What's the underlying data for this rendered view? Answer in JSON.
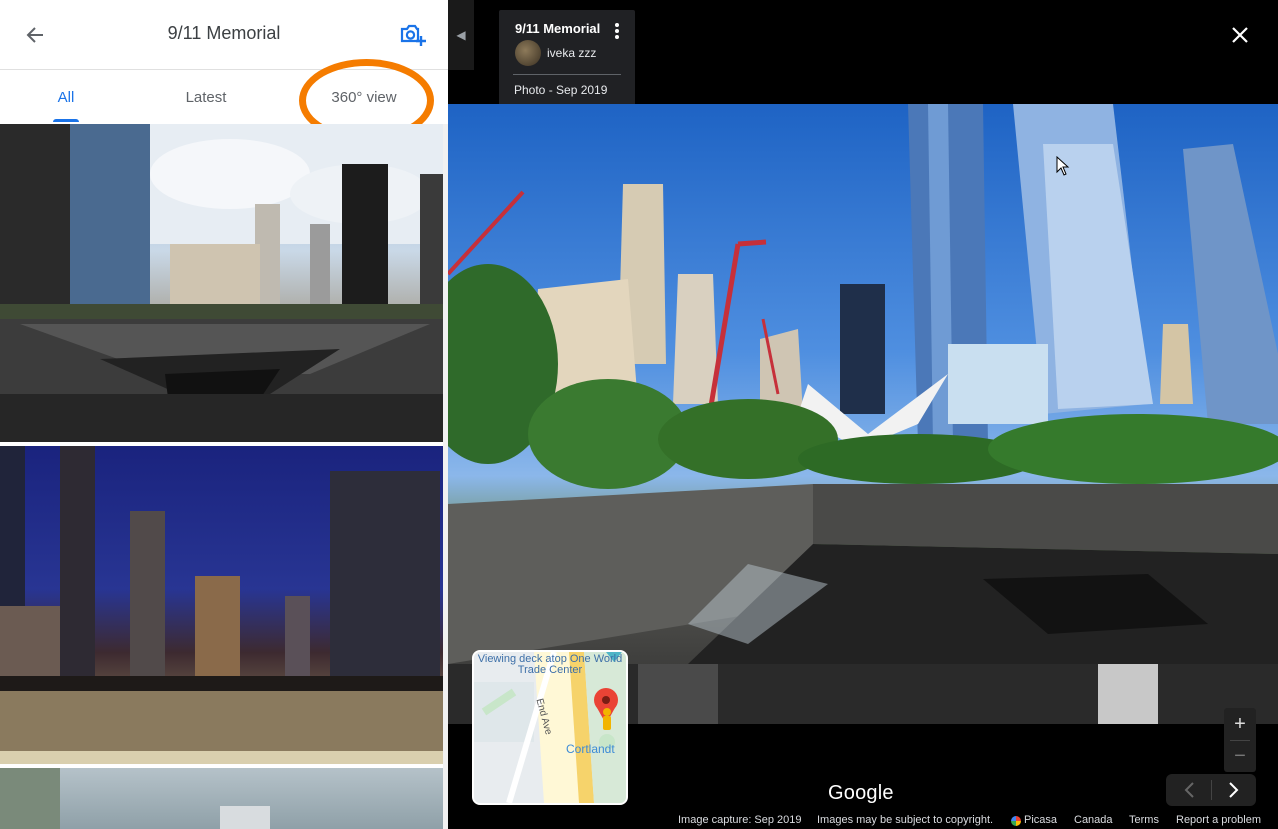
{
  "panel": {
    "title": "9/11 Memorial",
    "back_icon": "arrow-left-icon",
    "add_photo_icon": "camera-plus-icon",
    "tabs": [
      {
        "label": "All",
        "active": true
      },
      {
        "label": "Latest",
        "active": false
      },
      {
        "label": "360° view",
        "active": false
      }
    ],
    "annotation_color": "#f57c00",
    "thumbnails": [
      {
        "desc": "memorial pool daytime"
      },
      {
        "desc": "memorial pool night"
      },
      {
        "desc": "building"
      }
    ]
  },
  "viewer": {
    "info_card": {
      "title": "9/11 Memorial",
      "user": "iveka zzz",
      "date": "Photo - Sep 2019"
    },
    "minimap": {
      "label_top": "Viewing deck atop One World Trade Center",
      "label_street": "Cortlandt",
      "road_label": "End Ave"
    },
    "logo": "Google",
    "footer": {
      "capture": "Image capture: Sep 2019",
      "copyright": "Images may be subject to copyright.",
      "picasa": "Picasa",
      "region": "Canada",
      "terms": "Terms",
      "report": "Report a problem"
    }
  },
  "colors": {
    "accent": "#1a73e8",
    "annotation": "#f57c00"
  }
}
